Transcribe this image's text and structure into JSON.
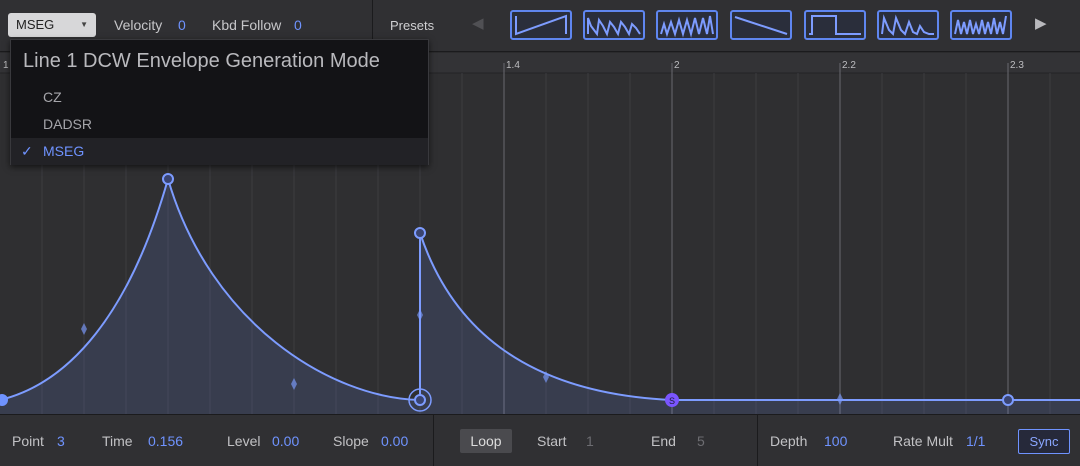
{
  "topbar": {
    "mode": {
      "value": "MSEG",
      "icon": "dropdown-caret-icon"
    },
    "velocity": {
      "label": "Velocity",
      "value": "0"
    },
    "kbd_follow": {
      "label": "Kbd Follow",
      "value": "0"
    },
    "presets_label": "Presets",
    "prev_icon": "◀",
    "next_icon": "▶",
    "presets": [
      "saw-down-wave",
      "stepped-decay-wave",
      "stepped-rise-wave",
      "ramp-down-wave",
      "square-wave",
      "double-decay-wave",
      "multi-peak-wave"
    ]
  },
  "ruler": {
    "labels": [
      "1",
      "1.4",
      "2",
      "2.2",
      "2.3"
    ]
  },
  "menu": {
    "title": "Line 1 DCW Envelope Generation Mode",
    "items": [
      {
        "label": "CZ",
        "selected": false
      },
      {
        "label": "DADSR",
        "selected": false
      },
      {
        "label": "MSEG",
        "selected": true
      }
    ],
    "check_mark": "✓"
  },
  "bottombar": {
    "point": {
      "label": "Point",
      "value": "3"
    },
    "time": {
      "label": "Time",
      "value": "0.156"
    },
    "level": {
      "label": "Level",
      "value": "0.00"
    },
    "slope": {
      "label": "Slope",
      "value": "0.00"
    },
    "loop": "Loop",
    "start": {
      "label": "Start",
      "value": "1"
    },
    "end": {
      "label": "End",
      "value": "5"
    },
    "depth": {
      "label": "Depth",
      "value": "100"
    },
    "rate_mult": {
      "label": "Rate Mult",
      "value": "1/1"
    },
    "sync": "Sync"
  },
  "colors": {
    "accent": "#6f93ff",
    "sustain_point": "#7a55ff",
    "background": "#2f2f31"
  }
}
